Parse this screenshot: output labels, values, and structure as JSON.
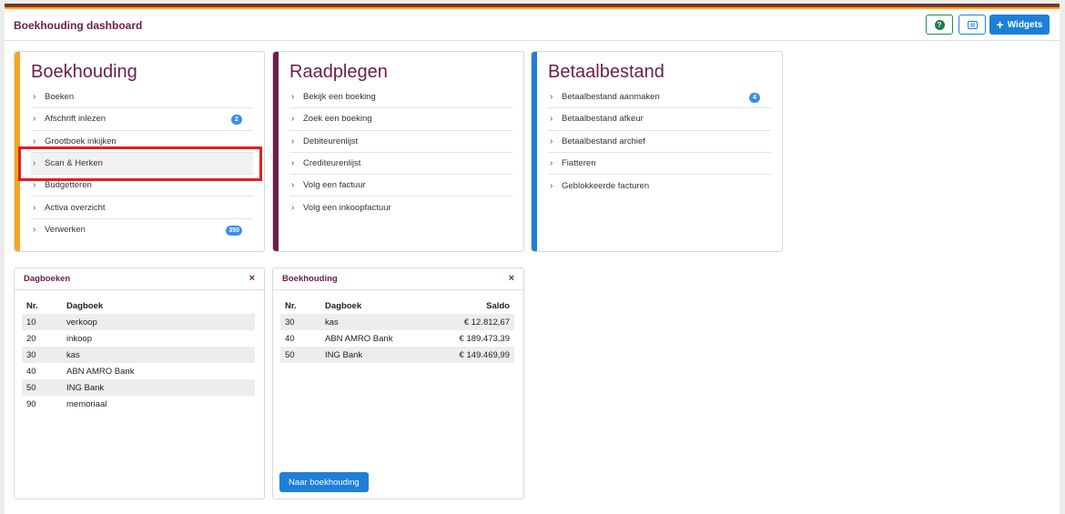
{
  "header": {
    "title": "Boekhouding dashboard",
    "help_icon_glyph": "?",
    "widgets_label": "Widgets",
    "plus_glyph": "+"
  },
  "colors": {
    "boekhouding_accent": "#f5a623",
    "raadplegen_accent": "#6a1e4a",
    "betaalbestand_accent": "#1e7fd8",
    "badge": "#3b8ee8",
    "highlight": "#e02020"
  },
  "chevron": "›",
  "menus": {
    "boekhouding": {
      "title": "Boekhouding",
      "items": [
        {
          "label": "Boeken",
          "badge": ""
        },
        {
          "label": "Afschrift inlezen",
          "badge": "2"
        },
        {
          "label": "Grootboek inkijken",
          "badge": ""
        },
        {
          "label": "Scan & Herken",
          "badge": ""
        },
        {
          "label": "Budgetteren",
          "badge": ""
        },
        {
          "label": "Activa overzicht",
          "badge": ""
        },
        {
          "label": "Verwerken",
          "badge": "350"
        }
      ]
    },
    "raadplegen": {
      "title": "Raadplegen",
      "items": [
        {
          "label": "Bekijk een boeking"
        },
        {
          "label": "Zoek een boeking"
        },
        {
          "label": "Debiteurenlijst"
        },
        {
          "label": "Crediteurenlijst"
        },
        {
          "label": "Volg een factuur"
        },
        {
          "label": "Volg een inkoopfactuur"
        }
      ]
    },
    "betaalbestand": {
      "title": "Betaalbestand",
      "items": [
        {
          "label": "Betaalbestand aanmaken",
          "badge": "4"
        },
        {
          "label": "Betaalbestand afkeur",
          "badge": ""
        },
        {
          "label": "Betaalbestand archief",
          "badge": ""
        },
        {
          "label": "Fiatteren",
          "badge": ""
        },
        {
          "label": "Geblokkeerde facturen",
          "badge": ""
        }
      ]
    }
  },
  "dagboeken": {
    "title": "Dagboeken",
    "close": "×",
    "headers": {
      "nr": "Nr.",
      "dagboek": "Dagboek"
    },
    "rows": [
      {
        "nr": "10",
        "name": "verkoop"
      },
      {
        "nr": "20",
        "name": "inkoop"
      },
      {
        "nr": "30",
        "name": "kas"
      },
      {
        "nr": "40",
        "name": "ABN AMRO Bank"
      },
      {
        "nr": "50",
        "name": "ING Bank"
      },
      {
        "nr": "90",
        "name": "memoriaal"
      }
    ]
  },
  "boekhouding_widget": {
    "title": "Boekhouding",
    "close": "×",
    "headers": {
      "nr": "Nr.",
      "dagboek": "Dagboek",
      "saldo": "Saldo"
    },
    "rows": [
      {
        "nr": "30",
        "name": "kas",
        "saldo": "€ 12.812,67"
      },
      {
        "nr": "40",
        "name": "ABN AMRO Bank",
        "saldo": "€ 189.473,39"
      },
      {
        "nr": "50",
        "name": "ING Bank",
        "saldo": "€ 149.469,99"
      }
    ],
    "button_label": "Naar boekhouding"
  }
}
